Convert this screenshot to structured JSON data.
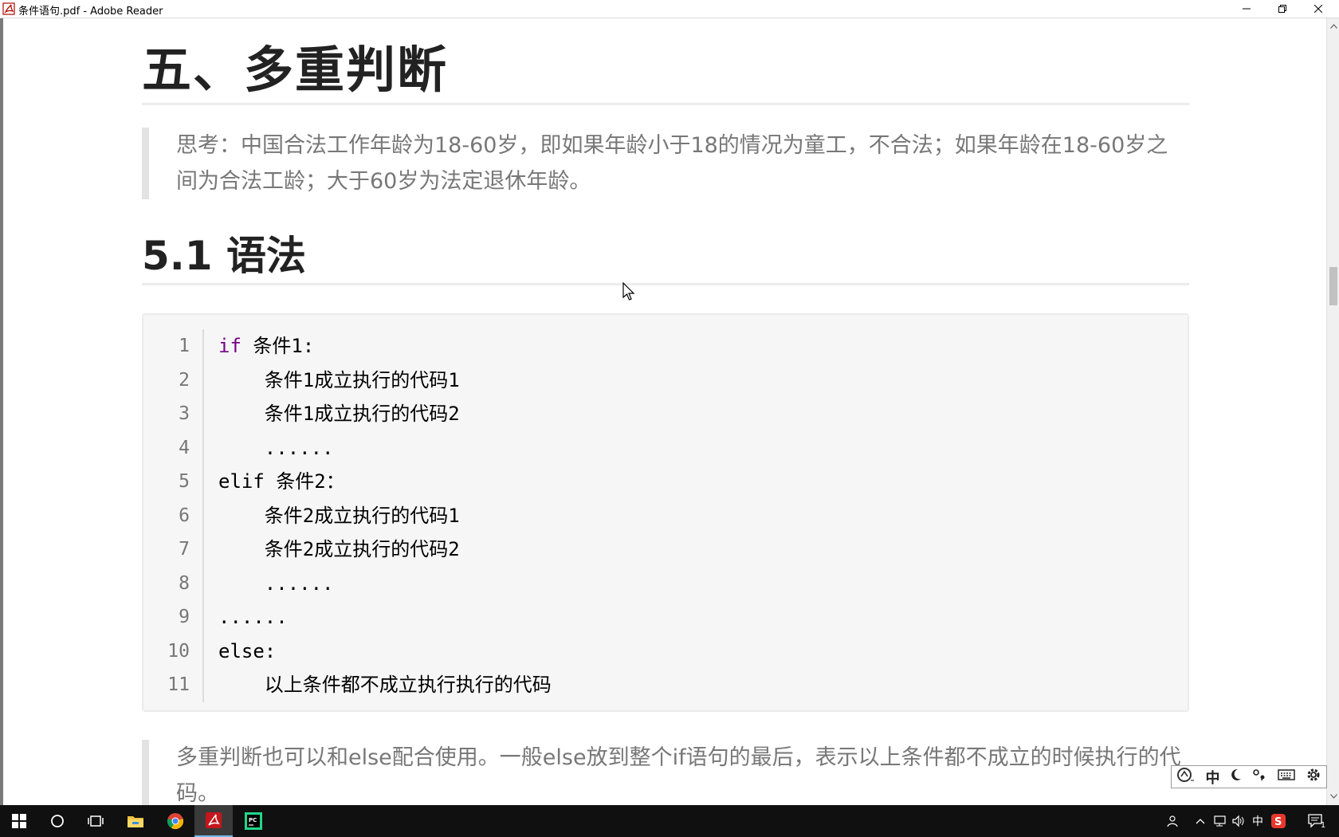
{
  "window": {
    "title": "条件语句.pdf - Adobe Reader",
    "minimize_icon": "minimize-icon",
    "restore_icon": "restore-icon",
    "close_icon": "close-icon"
  },
  "document": {
    "heading1": "五、多重判断",
    "quote1": "思考：中国合法工作年龄为18-60岁，即如果年龄小于18的情况为童工，不合法；如果年龄在18-60岁之间为合法工龄；大于60岁为法定退休年龄。",
    "heading2": "5.1 语法",
    "code_lines": [
      {
        "num": "1",
        "kw": "if",
        "text": " 条件1:"
      },
      {
        "num": "2",
        "kw": "",
        "text": "    条件1成立执行的代码1"
      },
      {
        "num": "3",
        "kw": "",
        "text": "    条件1成立执行的代码2"
      },
      {
        "num": "4",
        "kw": "",
        "text": "    ......"
      },
      {
        "num": "5",
        "kw": "",
        "text": "elif 条件2："
      },
      {
        "num": "6",
        "kw": "",
        "text": "    条件2成立执行的代码1"
      },
      {
        "num": "7",
        "kw": "",
        "text": "    条件2成立执行的代码2"
      },
      {
        "num": "8",
        "kw": "",
        "text": "    ......"
      },
      {
        "num": "9",
        "kw": "",
        "text": "......"
      },
      {
        "num": "10",
        "kw": "",
        "text": "else:"
      },
      {
        "num": "11",
        "kw": "",
        "text": "    以上条件都不成立执行执行的代码"
      }
    ],
    "quote2": "多重判断也可以和else配合使用。一般else放到整个if语句的最后，表示以上条件都不成立的时候执行的代码。"
  },
  "ime": {
    "mode": "中",
    "items": [
      "logo-icon",
      "中",
      "moon-icon",
      "punct-icon",
      "keyboard-icon",
      "gear-icon"
    ]
  },
  "taskbar": {
    "items": [
      "windows-start-icon",
      "search-icon",
      "task-view-icon",
      "file-explorer-icon",
      "chrome-icon",
      "adobe-reader-icon",
      "pycharm-icon"
    ],
    "tray_ime": "中",
    "notification_count": "1"
  },
  "colors": {
    "keyword": "#770088",
    "code_bg": "#f6f6f6",
    "quote_border": "#e3e3e3"
  }
}
